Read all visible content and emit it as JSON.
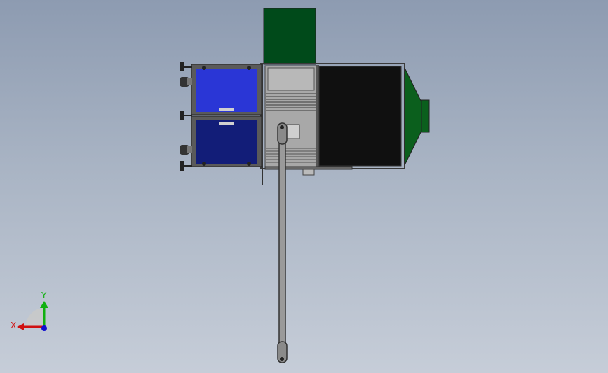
{
  "colors": {
    "background_top": "#8d9bb1",
    "background_bottom": "#c6cdd8",
    "hood_green": "#004a1a",
    "outlet_green": "#0b5f1d",
    "panel_blue_top": "#2a36d6",
    "panel_blue_bottom": "#121d78",
    "dark_chamber": "#101010",
    "axis_x": "#d01010",
    "axis_y": "#10b010",
    "axis_z": "#1010d0"
  },
  "triad": {
    "x_label": "X",
    "y_label": "Y"
  },
  "icons": {
    "triad": "coordinate-triad-icon"
  }
}
